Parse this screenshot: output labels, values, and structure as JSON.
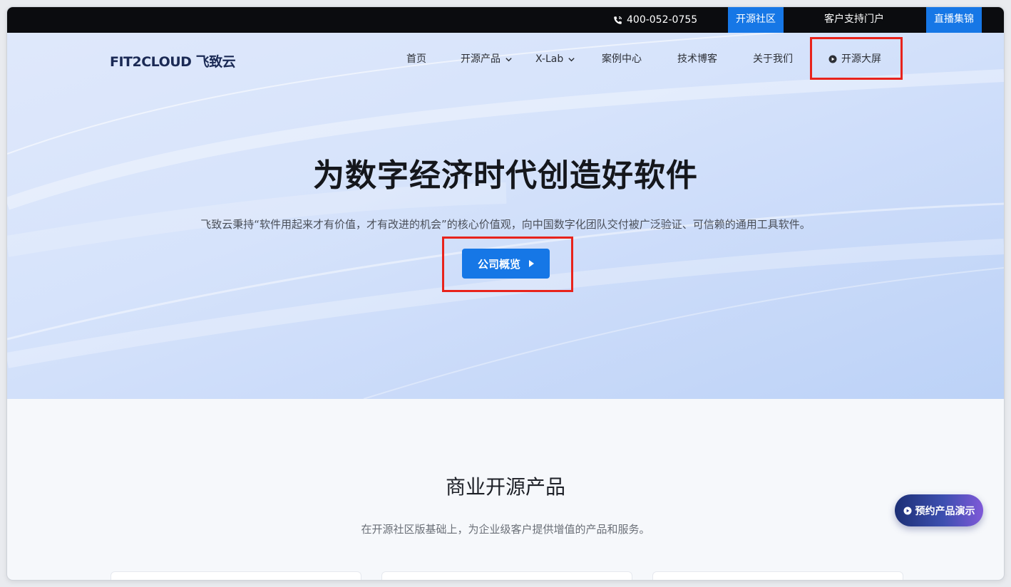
{
  "topbar": {
    "phone": "400-052-0755",
    "community": "开源社区",
    "support": "客户支持门户",
    "live": "直播集锦"
  },
  "nav": {
    "logo": "FIT2CLOUD 飞致云",
    "items": {
      "home": "首页",
      "products": "开源产品",
      "xlab": "X-Lab",
      "cases": "案例中心",
      "blog": "技术博客",
      "about": "关于我们",
      "screen": "开源大屏"
    }
  },
  "hero": {
    "title": "为数字经济时代创造好软件",
    "subtitle": "飞致云秉持“软件用起来才有价值，才有改进的机会”的核心价值观，向中国数字化团队交付被广泛验证、可信赖的通用工具软件。",
    "cta": "公司概览"
  },
  "products": {
    "title": "商业开源产品",
    "subtitle": "在开源社区版基础上，为企业级客户提供增值的产品和服务。"
  },
  "floating": {
    "demo": "预约产品演示"
  },
  "colors": {
    "accent": "#1677e6",
    "highlight": "#e8231c",
    "topbar_bg": "#0b0c0f"
  },
  "icons": [
    "phone-icon",
    "chevron-down-icon",
    "play-circle-icon",
    "triangle-right-icon"
  ]
}
